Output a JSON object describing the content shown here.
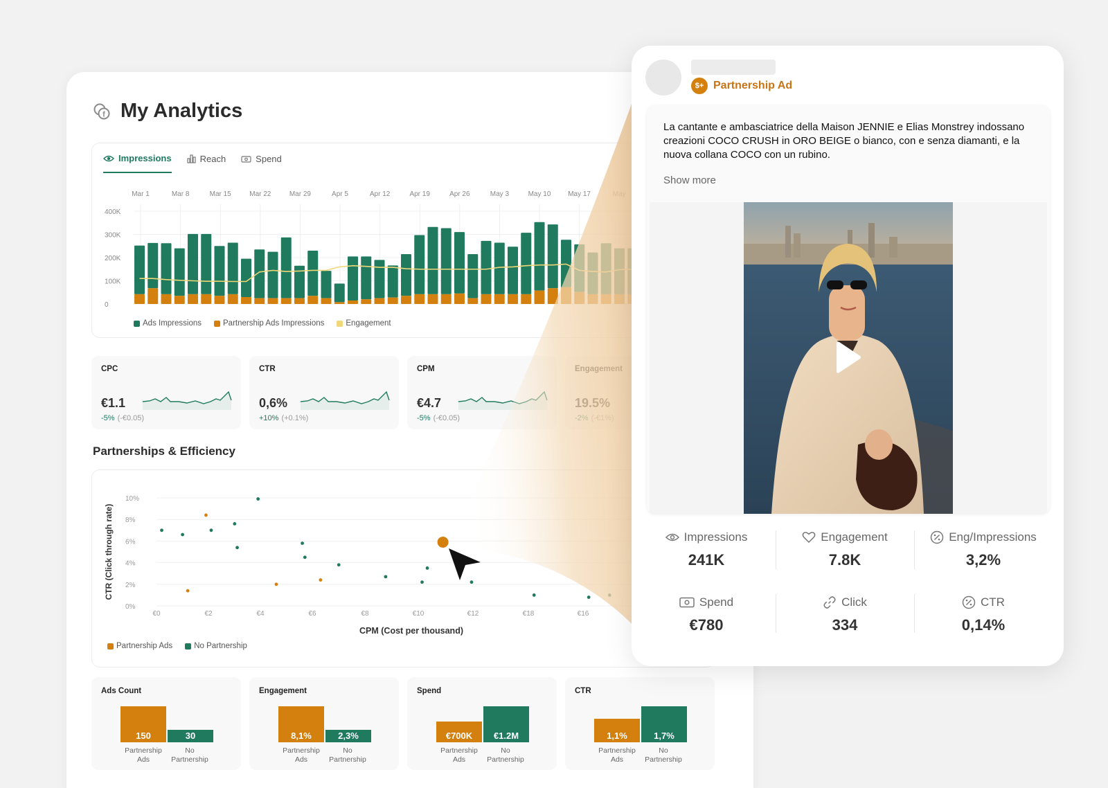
{
  "page": {
    "title": "My Analytics"
  },
  "tabs": [
    {
      "label": "Impressions",
      "icon": "eye-icon",
      "active": true
    },
    {
      "label": "Reach",
      "icon": "bar-chart-icon",
      "active": false
    },
    {
      "label": "Spend",
      "icon": "money-icon",
      "active": false
    }
  ],
  "colors": {
    "green": "#1f7a5e",
    "orange": "#d4800f",
    "yellow": "#f0d77a",
    "accent_text": "#c77414"
  },
  "chart_data": [
    {
      "type": "bar",
      "x_ticks": [
        "Mar 1",
        "Mar 8",
        "Mar 15",
        "Mar 22",
        "Mar 29",
        "Apr 5",
        "Apr 12",
        "Apr 19",
        "Apr 26",
        "May 3",
        "May 10",
        "May 17",
        "May"
      ],
      "y_ticks": [
        "400K",
        "300K",
        "200K",
        "100K",
        "0"
      ],
      "ylim": [
        0,
        400000
      ],
      "stacked": true,
      "series": [
        {
          "name": "Ads Impressions",
          "color": "#1f7a5e",
          "values": [
            210000,
            195000,
            220000,
            205000,
            260000,
            260000,
            215000,
            222000,
            165000,
            210000,
            200000,
            262000,
            140000,
            195000,
            118000,
            80000,
            190000,
            185000,
            165000,
            138000,
            180000,
            255000,
            290000,
            285000,
            265000,
            190000,
            230000,
            222000,
            205000,
            265000,
            295000,
            275000,
            205000,
            205000,
            180000,
            220000,
            198000,
            198000,
            210000,
            215000,
            235000
          ]
        },
        {
          "name": "Partnership Ads Impressions",
          "color": "#d4800f",
          "values": [
            42000,
            68000,
            42000,
            35000,
            42000,
            42000,
            35000,
            42000,
            30000,
            25000,
            25000,
            25000,
            25000,
            35000,
            25000,
            8000,
            15000,
            20000,
            25000,
            28000,
            35000,
            42000,
            42000,
            42000,
            45000,
            25000,
            42000,
            42000,
            42000,
            42000,
            58000,
            68000,
            72000,
            52000,
            42000,
            42000,
            42000,
            42000,
            28000,
            30000,
            68000
          ]
        },
        {
          "name": "Engagement",
          "color": "#f0d77a",
          "values": [
            110000,
            110000,
            105000,
            102000,
            100000,
            98000,
            98000,
            97000,
            97000,
            138000,
            145000,
            140000,
            142000,
            145000,
            145000,
            160000,
            165000,
            162000,
            158000,
            158000,
            152000,
            150000,
            150000,
            150000,
            150000,
            150000,
            150000,
            158000,
            160000,
            165000,
            168000,
            168000,
            172000,
            145000,
            140000,
            138000,
            148000,
            150000,
            150000,
            150000,
            150000
          ]
        }
      ]
    },
    {
      "type": "scatter",
      "xlabel": "CPM (Cost per thousand)",
      "ylabel": "CTR (Click through rate)",
      "x_ticks": [
        "€0",
        "€2",
        "€4",
        "€6",
        "€8",
        "€10",
        "€12",
        "€18",
        "€16"
      ],
      "y_ticks": [
        "10%",
        "8%",
        "6%",
        "4%",
        "2%",
        "0%"
      ],
      "ylim": [
        0,
        10
      ],
      "series": [
        {
          "name": "Partnership Ads",
          "color": "#d4800f",
          "points": [
            [
              1.2,
              1.4
            ],
            [
              1.9,
              8.4
            ],
            [
              4.6,
              2.0
            ],
            [
              6.3,
              2.4
            ],
            [
              11.0,
              5.9
            ]
          ]
        },
        {
          "name": "No Partnership",
          "color": "#1f7a5e",
          "points": [
            [
              0.2,
              7.0
            ],
            [
              1.0,
              6.6
            ],
            [
              2.1,
              7.0
            ],
            [
              3.0,
              7.6
            ],
            [
              3.1,
              5.4
            ],
            [
              3.9,
              9.9
            ],
            [
              5.6,
              5.8
            ],
            [
              5.7,
              4.5
            ],
            [
              7.0,
              3.8
            ],
            [
              8.8,
              2.7
            ],
            [
              10.2,
              2.2
            ],
            [
              10.4,
              3.5
            ],
            [
              12.1,
              2.2
            ],
            [
              14.5,
              1.0
            ],
            [
              16.6,
              0.8
            ],
            [
              17.4,
              1.0
            ]
          ]
        }
      ]
    },
    {
      "type": "bar",
      "title": "Ads Count",
      "categories": [
        "Partnership Ads",
        "No Partnership"
      ],
      "values": [
        150,
        30
      ],
      "labels": [
        "150",
        "30"
      ]
    },
    {
      "type": "bar",
      "title": "Engagement",
      "categories": [
        "Partnership Ads",
        "No Partnership"
      ],
      "values": [
        8.1,
        2.3
      ],
      "labels": [
        "8,1%",
        "2,3%"
      ]
    },
    {
      "type": "bar",
      "title": "Spend",
      "categories": [
        "Partnership Ads",
        "No Partnership"
      ],
      "values": [
        700000,
        1200000
      ],
      "labels": [
        "€700K",
        "€1.2M"
      ]
    },
    {
      "type": "bar",
      "title": "CTR",
      "categories": [
        "Partnership Ads",
        "No Partnership"
      ],
      "values": [
        1.1,
        1.7
      ],
      "labels": [
        "1,1%",
        "1,7%"
      ]
    }
  ],
  "kpis": [
    {
      "label": "CPC",
      "value": "€1.1",
      "delta": "-5%",
      "delta_abs": "(-€0.05)"
    },
    {
      "label": "CTR",
      "value": "0,6%",
      "delta": "+10%",
      "delta_abs": "(+0.1%)"
    },
    {
      "label": "CPM",
      "value": "€4.7",
      "delta": "-5%",
      "delta_abs": "(-€0.05)"
    },
    {
      "label": "Engagement",
      "value": "19.5%",
      "delta": "-2%",
      "delta_abs": "(-€1%)"
    }
  ],
  "section": {
    "title": "Partnerships & Efficiency"
  },
  "mini_captions": {
    "left": [
      "Partnership",
      "Ads"
    ],
    "right": [
      "No",
      "Partnership"
    ]
  },
  "popup": {
    "badge": "Partnership Ad",
    "badge_icon_text": "$+",
    "caption": "La cantante e ambasciatrice della Maison JENNIE e Elias Monstrey indossano creazioni COCO CRUSH in ORO BEIGE o bianco, con e senza diamanti, e la nuova collana COCO con un rubino.",
    "show_more": "Show more",
    "stats": [
      {
        "label": "Impressions",
        "value": "241K",
        "icon": "eye-icon"
      },
      {
        "label": "Engagement",
        "value": "7.8K",
        "icon": "heart-icon"
      },
      {
        "label": "Eng/Impressions",
        "value": "3,2%",
        "icon": "percent-icon"
      },
      {
        "label": "Spend",
        "value": "€780",
        "icon": "money-icon"
      },
      {
        "label": "Click",
        "value": "334",
        "icon": "link-icon"
      },
      {
        "label": "CTR",
        "value": "0,14%",
        "icon": "percent-icon"
      }
    ]
  }
}
